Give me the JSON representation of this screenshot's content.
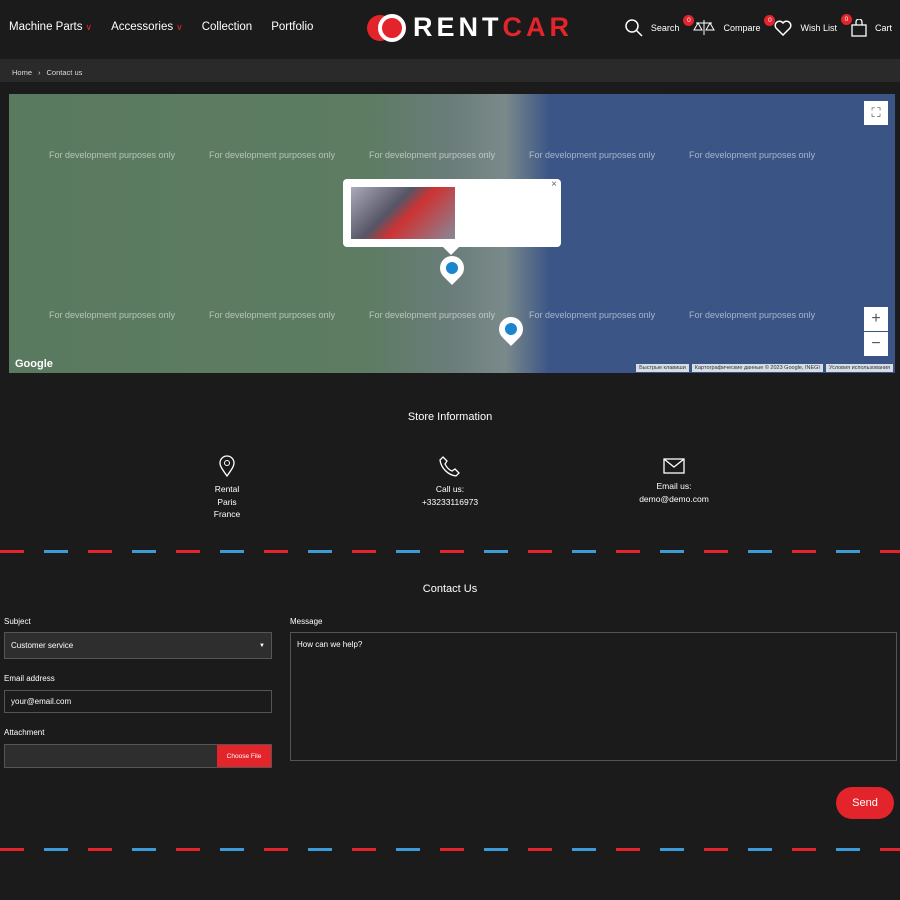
{
  "nav": {
    "items": [
      {
        "label": "Machine Parts",
        "dropdown": true
      },
      {
        "label": "Accessories",
        "dropdown": true
      },
      {
        "label": "Collection"
      },
      {
        "label": "Portfolio"
      }
    ]
  },
  "logo": {
    "part1": "RENT",
    "part2": "CAR"
  },
  "tools": {
    "search": "Search",
    "compare": "Compare",
    "compare_count": "0",
    "wishlist": "Wish List",
    "wishlist_count": "0",
    "cart": "Cart",
    "cart_count": "0"
  },
  "breadcrumb": {
    "home": "Home",
    "current": "Contact us"
  },
  "map": {
    "watermark": "For development purposes only",
    "google": "Google",
    "attribution": [
      "Быстрые клавиши",
      "Картографические данные © 2023 Google, INEGI",
      "Условия использования"
    ],
    "zoom_in": "+",
    "zoom_out": "−"
  },
  "store": {
    "title": "Store Information",
    "address": [
      "Rental",
      "Paris",
      "France"
    ],
    "call_label": "Call us:",
    "phone": "+33233116973",
    "email_label": "Email us:",
    "email": "demo@demo.com"
  },
  "contact": {
    "title": "Contact Us",
    "subject_label": "Subject",
    "subject_value": "Customer service",
    "email_label": "Email address",
    "email_placeholder": "your@email.com",
    "attachment_label": "Attachment",
    "choose_file": "Choose File",
    "message_label": "Message",
    "message_placeholder": "How can we help?",
    "send": "Send"
  },
  "colors": {
    "accent": "#e3242b",
    "blue": "#3c9ad6"
  }
}
